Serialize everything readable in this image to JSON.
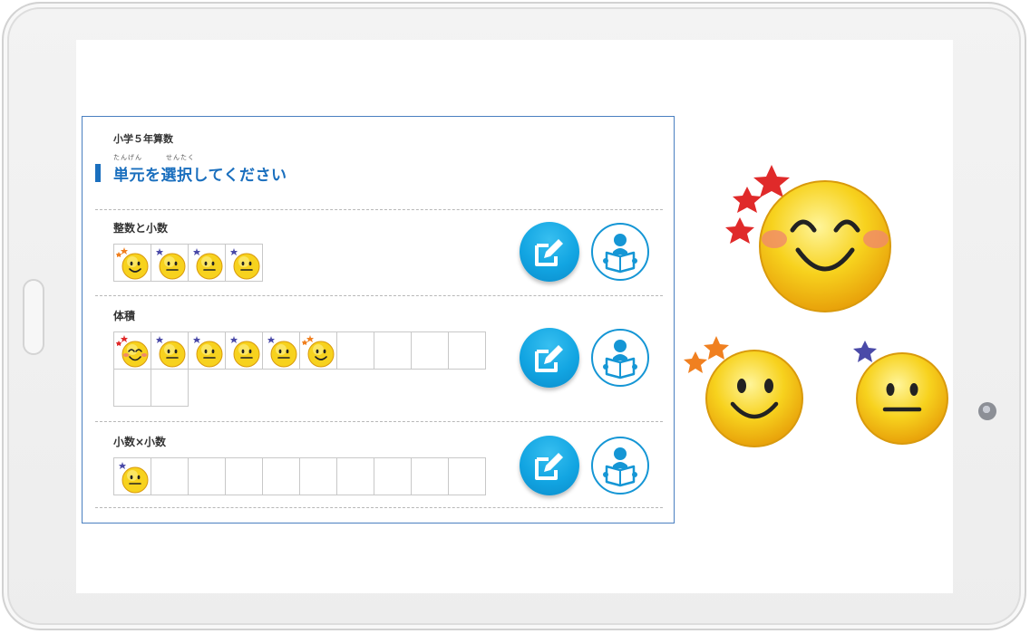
{
  "header": {
    "grade_label": "小学５年算数",
    "ruby_tangen": "たんげん",
    "ruby_sentaku": "せんたく",
    "title": "単元を選択してください"
  },
  "units": [
    {
      "name": "整数と小数",
      "cells": [
        "smile",
        "neutral",
        "neutral",
        "neutral"
      ]
    },
    {
      "name": "体積",
      "cells": [
        "laugh",
        "neutral",
        "neutral",
        "neutral",
        "neutral",
        "smile",
        "",
        "",
        "",
        "",
        "",
        ""
      ]
    },
    {
      "name": "小数×小数",
      "cells": [
        "neutral",
        "",
        "",
        "",
        "",
        "",
        "",
        "",
        "",
        ""
      ]
    }
  ],
  "icons": {
    "practice_button": "pencil-edit-icon",
    "study_button": "person-reading-book-icon"
  },
  "colors": {
    "accent": "#1a6fbe",
    "button_blue": "#12a5e2",
    "face_yellow": "#f7d21e",
    "star_red": "#e02a2a",
    "star_orange": "#f08020",
    "star_purple": "#4a4aa8"
  }
}
